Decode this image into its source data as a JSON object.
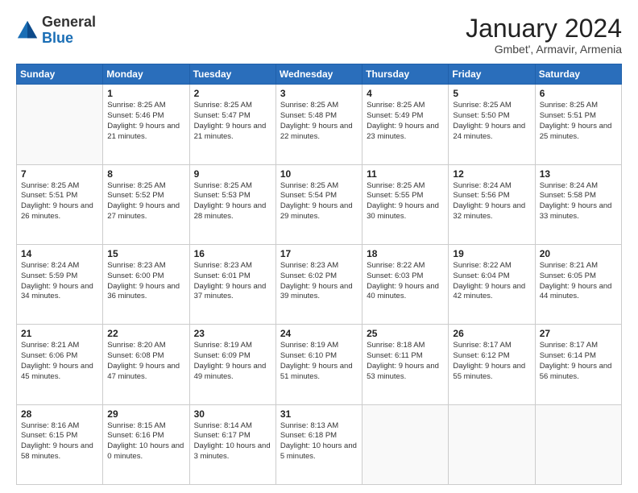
{
  "header": {
    "logo": {
      "general": "General",
      "blue": "Blue"
    },
    "title": "January 2024",
    "subtitle": "Gmbet', Armavir, Armenia"
  },
  "weekdays": [
    "Sunday",
    "Monday",
    "Tuesday",
    "Wednesday",
    "Thursday",
    "Friday",
    "Saturday"
  ],
  "weeks": [
    [
      {
        "day": "",
        "info": ""
      },
      {
        "day": "1",
        "info": "Sunrise: 8:25 AM\nSunset: 5:46 PM\nDaylight: 9 hours\nand 21 minutes."
      },
      {
        "day": "2",
        "info": "Sunrise: 8:25 AM\nSunset: 5:47 PM\nDaylight: 9 hours\nand 21 minutes."
      },
      {
        "day": "3",
        "info": "Sunrise: 8:25 AM\nSunset: 5:48 PM\nDaylight: 9 hours\nand 22 minutes."
      },
      {
        "day": "4",
        "info": "Sunrise: 8:25 AM\nSunset: 5:49 PM\nDaylight: 9 hours\nand 23 minutes."
      },
      {
        "day": "5",
        "info": "Sunrise: 8:25 AM\nSunset: 5:50 PM\nDaylight: 9 hours\nand 24 minutes."
      },
      {
        "day": "6",
        "info": "Sunrise: 8:25 AM\nSunset: 5:51 PM\nDaylight: 9 hours\nand 25 minutes."
      }
    ],
    [
      {
        "day": "7",
        "info": "Sunrise: 8:25 AM\nSunset: 5:51 PM\nDaylight: 9 hours\nand 26 minutes."
      },
      {
        "day": "8",
        "info": "Sunrise: 8:25 AM\nSunset: 5:52 PM\nDaylight: 9 hours\nand 27 minutes."
      },
      {
        "day": "9",
        "info": "Sunrise: 8:25 AM\nSunset: 5:53 PM\nDaylight: 9 hours\nand 28 minutes."
      },
      {
        "day": "10",
        "info": "Sunrise: 8:25 AM\nSunset: 5:54 PM\nDaylight: 9 hours\nand 29 minutes."
      },
      {
        "day": "11",
        "info": "Sunrise: 8:25 AM\nSunset: 5:55 PM\nDaylight: 9 hours\nand 30 minutes."
      },
      {
        "day": "12",
        "info": "Sunrise: 8:24 AM\nSunset: 5:56 PM\nDaylight: 9 hours\nand 32 minutes."
      },
      {
        "day": "13",
        "info": "Sunrise: 8:24 AM\nSunset: 5:58 PM\nDaylight: 9 hours\nand 33 minutes."
      }
    ],
    [
      {
        "day": "14",
        "info": "Sunrise: 8:24 AM\nSunset: 5:59 PM\nDaylight: 9 hours\nand 34 minutes."
      },
      {
        "day": "15",
        "info": "Sunrise: 8:23 AM\nSunset: 6:00 PM\nDaylight: 9 hours\nand 36 minutes."
      },
      {
        "day": "16",
        "info": "Sunrise: 8:23 AM\nSunset: 6:01 PM\nDaylight: 9 hours\nand 37 minutes."
      },
      {
        "day": "17",
        "info": "Sunrise: 8:23 AM\nSunset: 6:02 PM\nDaylight: 9 hours\nand 39 minutes."
      },
      {
        "day": "18",
        "info": "Sunrise: 8:22 AM\nSunset: 6:03 PM\nDaylight: 9 hours\nand 40 minutes."
      },
      {
        "day": "19",
        "info": "Sunrise: 8:22 AM\nSunset: 6:04 PM\nDaylight: 9 hours\nand 42 minutes."
      },
      {
        "day": "20",
        "info": "Sunrise: 8:21 AM\nSunset: 6:05 PM\nDaylight: 9 hours\nand 44 minutes."
      }
    ],
    [
      {
        "day": "21",
        "info": "Sunrise: 8:21 AM\nSunset: 6:06 PM\nDaylight: 9 hours\nand 45 minutes."
      },
      {
        "day": "22",
        "info": "Sunrise: 8:20 AM\nSunset: 6:08 PM\nDaylight: 9 hours\nand 47 minutes."
      },
      {
        "day": "23",
        "info": "Sunrise: 8:19 AM\nSunset: 6:09 PM\nDaylight: 9 hours\nand 49 minutes."
      },
      {
        "day": "24",
        "info": "Sunrise: 8:19 AM\nSunset: 6:10 PM\nDaylight: 9 hours\nand 51 minutes."
      },
      {
        "day": "25",
        "info": "Sunrise: 8:18 AM\nSunset: 6:11 PM\nDaylight: 9 hours\nand 53 minutes."
      },
      {
        "day": "26",
        "info": "Sunrise: 8:17 AM\nSunset: 6:12 PM\nDaylight: 9 hours\nand 55 minutes."
      },
      {
        "day": "27",
        "info": "Sunrise: 8:17 AM\nSunset: 6:14 PM\nDaylight: 9 hours\nand 56 minutes."
      }
    ],
    [
      {
        "day": "28",
        "info": "Sunrise: 8:16 AM\nSunset: 6:15 PM\nDaylight: 9 hours\nand 58 minutes."
      },
      {
        "day": "29",
        "info": "Sunrise: 8:15 AM\nSunset: 6:16 PM\nDaylight: 10 hours\nand 0 minutes."
      },
      {
        "day": "30",
        "info": "Sunrise: 8:14 AM\nSunset: 6:17 PM\nDaylight: 10 hours\nand 3 minutes."
      },
      {
        "day": "31",
        "info": "Sunrise: 8:13 AM\nSunset: 6:18 PM\nDaylight: 10 hours\nand 5 minutes."
      },
      {
        "day": "",
        "info": ""
      },
      {
        "day": "",
        "info": ""
      },
      {
        "day": "",
        "info": ""
      }
    ]
  ]
}
